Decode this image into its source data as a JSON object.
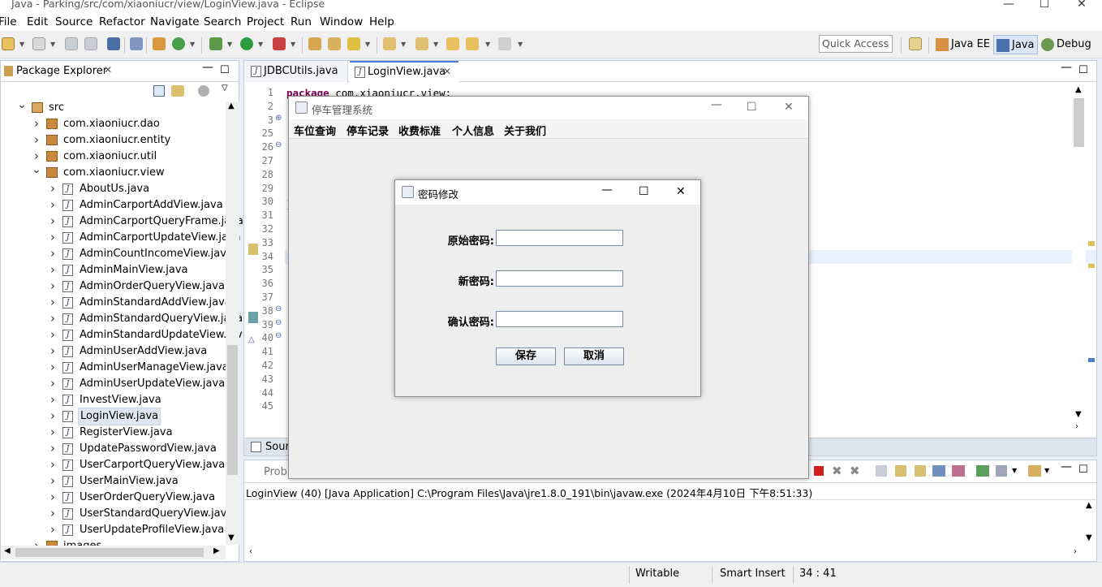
{
  "window": {
    "title": "Java - Parking/src/com/xiaoniucr/view/LoginView.java - Eclipse",
    "minimize": "—",
    "maximize": "☐",
    "close": "✕"
  },
  "menu": [
    "File",
    "Edit",
    "Source",
    "Refactor",
    "Navigate",
    "Search",
    "Project",
    "Run",
    "Window",
    "Help"
  ],
  "toolbar": {
    "quick_access": "Quick Access",
    "perspectives": [
      {
        "label": "Java EE",
        "icon": "java-ee-perspective-icon"
      },
      {
        "label": "Java",
        "icon": "java-perspective-icon",
        "active": true
      },
      {
        "label": "Debug",
        "icon": "debug-perspective-icon"
      }
    ]
  },
  "package_explorer": {
    "title": "Package Explorer",
    "items": [
      {
        "label": "src",
        "level": 0,
        "expanded": true,
        "type": "folder"
      },
      {
        "label": "com.xiaoniucr.dao",
        "level": 1,
        "expanded": false,
        "type": "package"
      },
      {
        "label": "com.xiaoniucr.entity",
        "level": 1,
        "expanded": false,
        "type": "package"
      },
      {
        "label": "com.xiaoniucr.util",
        "level": 1,
        "expanded": false,
        "type": "package"
      },
      {
        "label": "com.xiaoniucr.view",
        "level": 1,
        "expanded": true,
        "type": "package"
      },
      {
        "label": "AboutUs.java",
        "level": 2,
        "type": "java"
      },
      {
        "label": "AdminCarportAddView.java",
        "level": 2,
        "type": "java"
      },
      {
        "label": "AdminCarportQueryFrame.java",
        "level": 2,
        "type": "java"
      },
      {
        "label": "AdminCarportUpdateView.java",
        "level": 2,
        "type": "java"
      },
      {
        "label": "AdminCountIncomeView.java",
        "level": 2,
        "type": "java"
      },
      {
        "label": "AdminMainView.java",
        "level": 2,
        "type": "java"
      },
      {
        "label": "AdminOrderQueryView.java",
        "level": 2,
        "type": "java"
      },
      {
        "label": "AdminStandardAddView.java",
        "level": 2,
        "type": "java"
      },
      {
        "label": "AdminStandardQueryView.java",
        "level": 2,
        "type": "java"
      },
      {
        "label": "AdminStandardUpdateView.jav",
        "level": 2,
        "type": "java"
      },
      {
        "label": "AdminUserAddView.java",
        "level": 2,
        "type": "java"
      },
      {
        "label": "AdminUserManageView.java",
        "level": 2,
        "type": "java"
      },
      {
        "label": "AdminUserUpdateView.java",
        "level": 2,
        "type": "java"
      },
      {
        "label": "InvestView.java",
        "level": 2,
        "type": "java"
      },
      {
        "label": "LoginView.java",
        "level": 2,
        "type": "java",
        "selected": true
      },
      {
        "label": "RegisterView.java",
        "level": 2,
        "type": "java"
      },
      {
        "label": "UpdatePasswordView.java",
        "level": 2,
        "type": "java"
      },
      {
        "label": "UserCarportQueryView.java",
        "level": 2,
        "type": "java"
      },
      {
        "label": "UserMainView.java",
        "level": 2,
        "type": "java"
      },
      {
        "label": "UserOrderQueryView.java",
        "level": 2,
        "type": "java"
      },
      {
        "label": "UserStandardQueryView.java",
        "level": 2,
        "type": "java"
      },
      {
        "label": "UserUpdateProfileView.java",
        "level": 2,
        "type": "java"
      },
      {
        "label": "images",
        "level": 1,
        "expanded": false,
        "type": "package"
      }
    ]
  },
  "editor": {
    "tabs": [
      {
        "label": "JDBCUtils.java",
        "active": false
      },
      {
        "label": "LoginView.java",
        "active": true
      }
    ],
    "code_line1": "package com.xiaoniucr.view;",
    "line_numbers": [
      "1",
      "2",
      "3",
      "25",
      "26",
      "27",
      "28",
      "29",
      "30",
      "31",
      "32",
      "33",
      "34",
      "35",
      "36",
      "37",
      "38",
      "39",
      "40",
      "41",
      "42",
      "43",
      "44",
      "45"
    ],
    "bottom_tab": "Sour"
  },
  "console": {
    "tab": "Probl",
    "launch": "LoginView (40) [Java Application] C:\\Program Files\\Java\\jre1.8.0_191\\bin\\javaw.exe (2024年4月10日 下午8:51:33)"
  },
  "status": {
    "writable": "Writable",
    "insert": "Smart Insert",
    "position": "34 : 41"
  },
  "app_frame": {
    "title": "停车管理系统",
    "menu": [
      "车位查询",
      "停车记录",
      "收费标准",
      "个人信息",
      "关于我们"
    ]
  },
  "dialog": {
    "title": "密码修改",
    "fields": [
      {
        "label": "原始密码:",
        "value": ""
      },
      {
        "label": "新密码:",
        "value": ""
      },
      {
        "label": "确认密码:",
        "value": ""
      }
    ],
    "save": "保存",
    "cancel": "取消"
  }
}
